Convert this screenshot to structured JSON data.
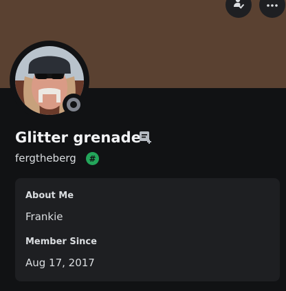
{
  "profile": {
    "display_name": "Glitter grenade",
    "username": "fergtheberg",
    "badge_symbol": "#",
    "status": "offline"
  },
  "icons": {
    "friend": "add-friend-icon",
    "more": "more-icon",
    "note": "note-icon",
    "status": "offline-status-icon"
  },
  "about": {
    "about_title": "About Me",
    "about_text": "Frankie",
    "member_since_title": "Member Since",
    "member_since_value": "Aug 17, 2017"
  },
  "colors": {
    "banner": "#5a4131",
    "background": "#111214",
    "card": "#1e1f22",
    "badge": "#23a55a",
    "offline": "#80848e"
  }
}
